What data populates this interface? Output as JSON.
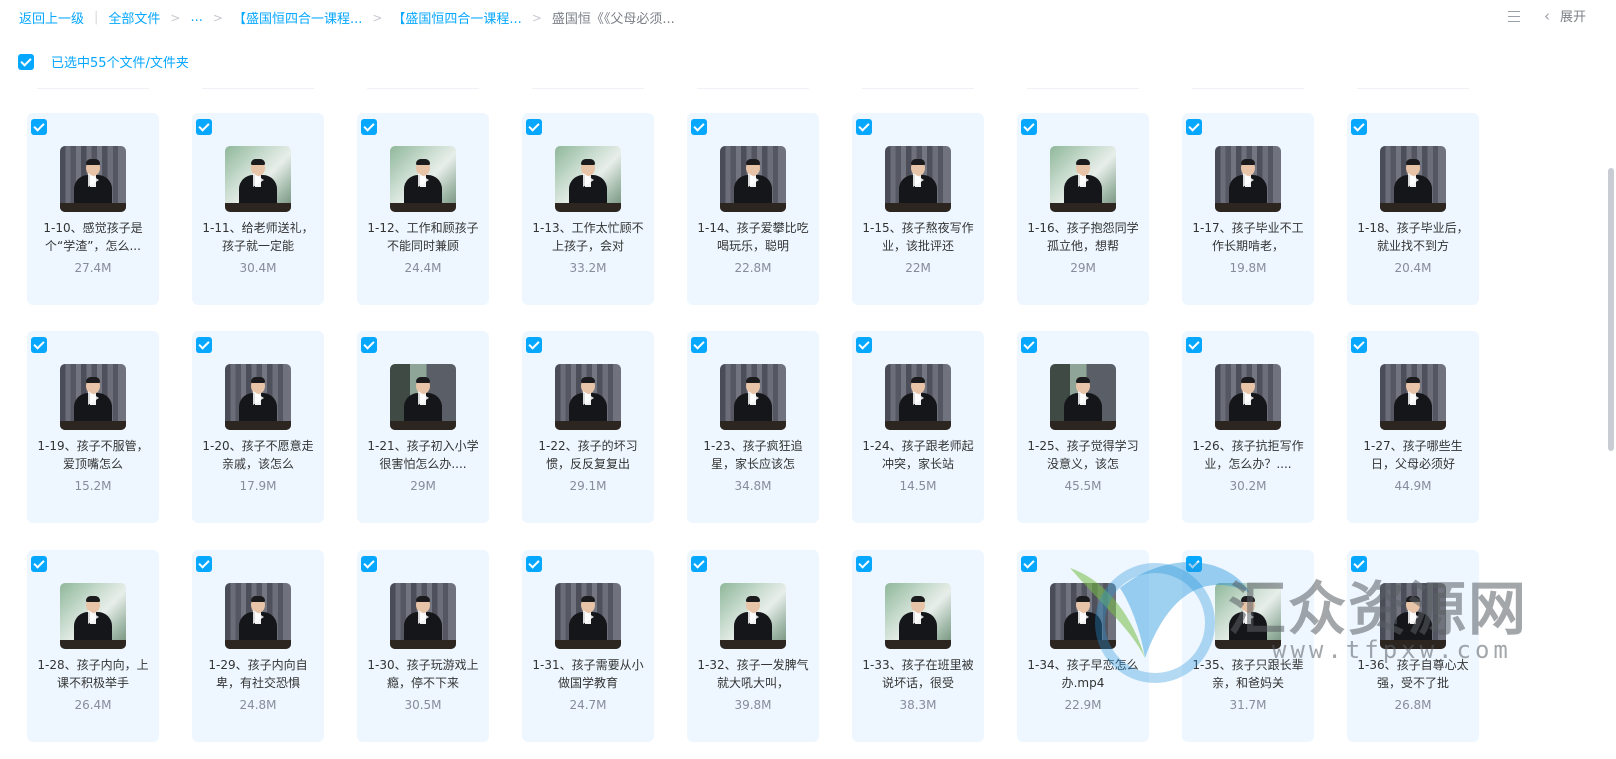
{
  "breadcrumb": {
    "back": "返回上一级",
    "all_files": "全部文件",
    "ellipsis": "...",
    "level1": "【盛国恒四合一课程...",
    "level2": "【盛国恒四合一课程...",
    "current": "盛国恒《《父母必须..."
  },
  "toolbar": {
    "list_icon": "list-view-icon",
    "expand_label": "展开"
  },
  "selection": {
    "label": "已选中55个文件/文件夹",
    "all_checked": true
  },
  "accent_color": "#06a7ff",
  "files": [
    {
      "name": "1-10、感觉孩子是个“学渣”，怎么...",
      "size": "27.4M",
      "thumb": "gray"
    },
    {
      "name": "1-11、给老师送礼，孩子就一定能",
      "size": "30.4M",
      "thumb": "green"
    },
    {
      "name": "1-12、工作和顾孩子不能同时兼顾",
      "size": "24.4M",
      "thumb": "green"
    },
    {
      "name": "1-13、工作太忙顾不上孩子，会对",
      "size": "33.2M",
      "thumb": "green"
    },
    {
      "name": "1-14、孩子爱攀比吃喝玩乐，聪明",
      "size": "22.8M",
      "thumb": "gray"
    },
    {
      "name": "1-15、孩子熬夜写作业，该批评还",
      "size": "22M",
      "thumb": "gray"
    },
    {
      "name": "1-16、孩子抱怨同学孤立他，想帮",
      "size": "29M",
      "thumb": "green"
    },
    {
      "name": "1-17、孩子毕业不工作长期啃老，",
      "size": "19.8M",
      "thumb": "gray"
    },
    {
      "name": "1-18、孩子毕业后，就业找不到方",
      "size": "20.4M",
      "thumb": "gray"
    },
    {
      "name": "1-19、孩子不服管，爱顶嘴怎么",
      "size": "15.2M",
      "thumb": "gray"
    },
    {
      "name": "1-20、孩子不愿意走亲戚，该怎么",
      "size": "17.9M",
      "thumb": "gray"
    },
    {
      "name": "1-21、孩子初入小学很害怕怎么办....",
      "size": "29M",
      "thumb": "mixed"
    },
    {
      "name": "1-22、孩子的坏习惯，反反复复出",
      "size": "29.1M",
      "thumb": "gray"
    },
    {
      "name": "1-23、孩子疯狂追星，家长应该怎",
      "size": "34.8M",
      "thumb": "gray"
    },
    {
      "name": "1-24、孩子跟老师起冲突，家长站",
      "size": "14.5M",
      "thumb": "gray"
    },
    {
      "name": "1-25、孩子觉得学习没意义，该怎",
      "size": "45.5M",
      "thumb": "mixed"
    },
    {
      "name": "1-26、孩子抗拒写作业，怎么办？....",
      "size": "30.2M",
      "thumb": "gray"
    },
    {
      "name": "1-27、孩子哪些生日，父母必须好",
      "size": "44.9M",
      "thumb": "gray"
    },
    {
      "name": "1-28、孩子内向，上课不积极举手",
      "size": "26.4M",
      "thumb": "green"
    },
    {
      "name": "1-29、孩子内向自卑，有社交恐惧",
      "size": "24.8M",
      "thumb": "gray"
    },
    {
      "name": "1-30、孩子玩游戏上瘾，停不下来",
      "size": "30.5M",
      "thumb": "gray"
    },
    {
      "name": "1-31、孩子需要从小做国学教育",
      "size": "24.7M",
      "thumb": "gray"
    },
    {
      "name": "1-32、孩子一发脾气就大吼大叫，",
      "size": "39.8M",
      "thumb": "green"
    },
    {
      "name": "1-33、孩子在班里被说坏话，很受",
      "size": "38.3M",
      "thumb": "green"
    },
    {
      "name": "1-34、孩子早恋怎么办.mp4",
      "size": "22.9M",
      "thumb": "gray"
    },
    {
      "name": "1-35、孩子只跟长辈亲，和爸妈关",
      "size": "31.7M",
      "thumb": "green"
    },
    {
      "name": "1-36、孩子自尊心太强，受不了批",
      "size": "26.8M",
      "thumb": "gray"
    }
  ],
  "watermark": {
    "title": "汇众资源网",
    "url": "www.tfpxw.com"
  }
}
